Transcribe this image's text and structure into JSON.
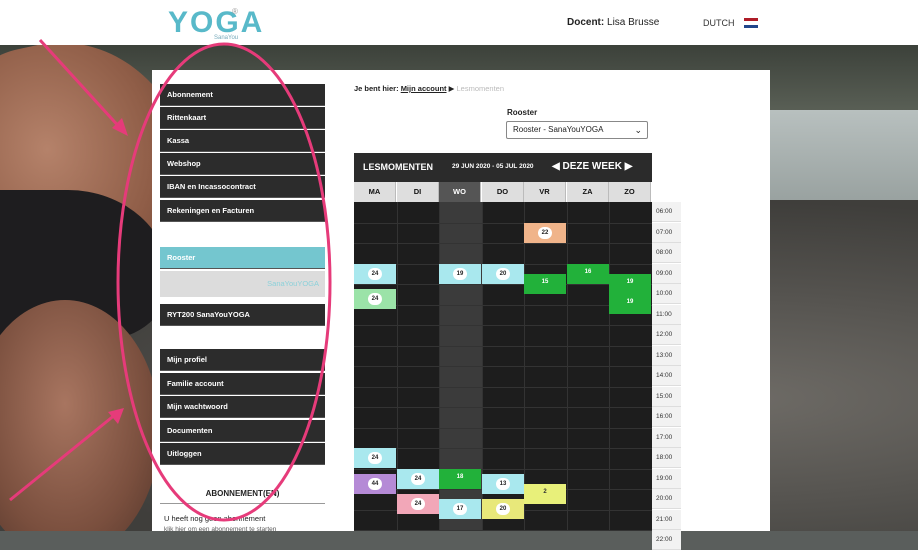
{
  "header": {
    "logo": "YOGA",
    "logo_reg": "®",
    "logo_sub": "SanaYou",
    "docent_label": "Docent:",
    "docent_name": "Lisa Brusse",
    "language": "DUTCH"
  },
  "sidebar": {
    "group1": [
      "Abonnement",
      "Rittenkaart",
      "Kassa",
      "Webshop",
      "IBAN en Incassocontract",
      "Rekeningen en Facturen"
    ],
    "rooster_active": "Rooster",
    "rooster_sub": "SanaYouYOGA",
    "ryt": "RYT200 SanaYouYOGA",
    "group2": [
      "Mijn profiel",
      "Familie account",
      "Mijn wachtwoord",
      "Documenten",
      "Uitloggen"
    ],
    "abonnementen_title": "ABONNEMENT(EN)",
    "abonnementen_text": "U heeft nog geen abonnement",
    "abonnementen_link": "klik hier om een abonnement te starten"
  },
  "breadcrumb": {
    "prefix": "Je bent hier:",
    "link": "Mijn account",
    "sep": "▶",
    "current": "Lesmomenten"
  },
  "rooster": {
    "label": "Rooster",
    "selected": "Rooster - SanaYouYOGA"
  },
  "calendar": {
    "title": "LESMOMENTEN",
    "date_range": "29 JUN 2020 - 05 JUL 2020",
    "week_label": "◀ DEZE WEEK ▶",
    "days": [
      "MA",
      "DI",
      "WO",
      "DO",
      "VR",
      "ZA",
      "ZO"
    ],
    "today_index": 2,
    "times": [
      "06:00",
      "07:00",
      "08:00",
      "09:00",
      "10:00",
      "11:00",
      "12:00",
      "13:00",
      "14:00",
      "15:00",
      "16:00",
      "17:00",
      "18:00",
      "19:00",
      "20:00",
      "21:00",
      "22:00"
    ],
    "events": [
      {
        "day": 4,
        "hour": 7.0,
        "count": "22",
        "color": "#f0b48a",
        "style": "badge"
      },
      {
        "day": 0,
        "hour": 9.0,
        "count": "24",
        "color": "#a9e8ee",
        "style": "badge"
      },
      {
        "day": 2,
        "hour": 9.0,
        "count": "19",
        "color": "#a9e8ee",
        "style": "badge"
      },
      {
        "day": 3,
        "hour": 9.0,
        "count": "20",
        "color": "#a9e8ee",
        "style": "badge"
      },
      {
        "day": 4,
        "hour": 9.5,
        "count": "15",
        "color": "#22b13a",
        "style": "text"
      },
      {
        "day": 5,
        "hour": 9.0,
        "count": "16",
        "color": "#22b13a",
        "style": "text"
      },
      {
        "day": 6,
        "hour": 9.5,
        "count": "19",
        "color": "#22b13a",
        "style": "text"
      },
      {
        "day": 0,
        "hour": 10.25,
        "count": "24",
        "color": "#9be3a8",
        "style": "badge"
      },
      {
        "day": 6,
        "hour": 10.5,
        "count": "19",
        "color": "#22b13a",
        "style": "text"
      },
      {
        "day": 0,
        "hour": 18.0,
        "count": "24",
        "color": "#a9e8ee",
        "style": "badge"
      },
      {
        "day": 0,
        "hour": 19.25,
        "count": "44",
        "color": "#b58ad6",
        "style": "badge"
      },
      {
        "day": 1,
        "hour": 19.0,
        "count": "24",
        "color": "#a9e8ee",
        "style": "badge"
      },
      {
        "day": 2,
        "hour": 19.0,
        "count": "18",
        "color": "#22b13a",
        "style": "text"
      },
      {
        "day": 3,
        "hour": 19.25,
        "count": "13",
        "color": "#a9e8ee",
        "style": "badge"
      },
      {
        "day": 4,
        "hour": 19.75,
        "count": "2",
        "color": "#e8f07a",
        "style": "textdark"
      },
      {
        "day": 1,
        "hour": 20.25,
        "count": "24",
        "color": "#f2a7b8",
        "style": "badge"
      },
      {
        "day": 2,
        "hour": 20.5,
        "count": "17",
        "color": "#a9e8ee",
        "style": "badge"
      },
      {
        "day": 3,
        "hour": 20.5,
        "count": "20",
        "color": "#e8e87a",
        "style": "badge"
      }
    ]
  },
  "colors": {
    "accent": "#74c6cf",
    "menu_bg": "#2c2c2c",
    "annotation": "#e63b7a"
  }
}
